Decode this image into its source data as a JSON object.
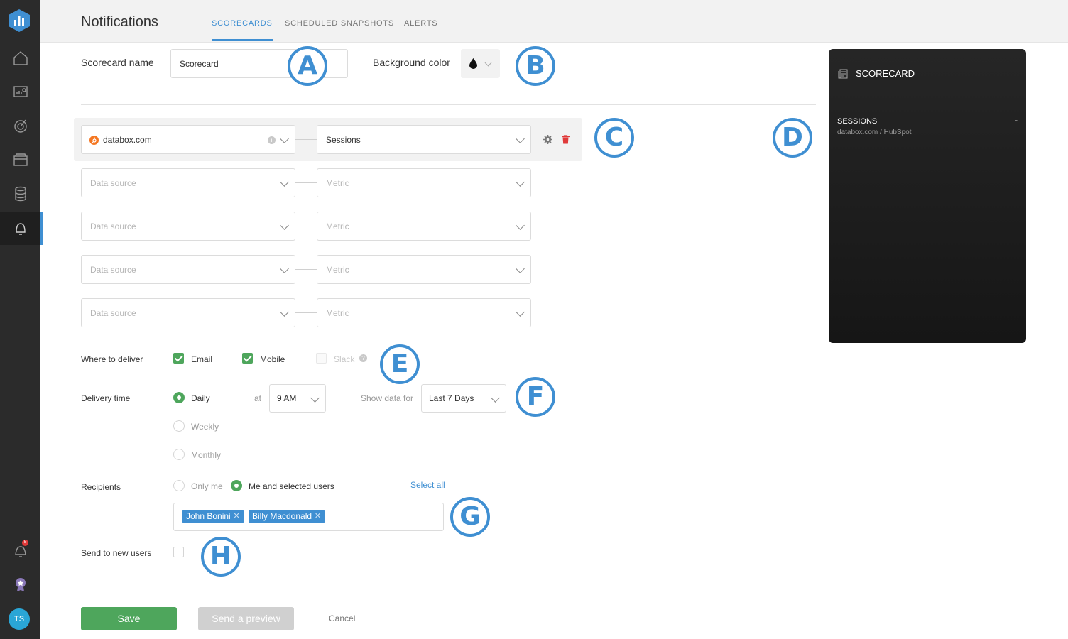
{
  "header": {
    "title": "Notifications",
    "tabs": [
      {
        "label": "SCORECARDS",
        "active": true
      },
      {
        "label": "SCHEDULED SNAPSHOTS",
        "active": false
      },
      {
        "label": "ALERTS",
        "active": false
      }
    ]
  },
  "sidebar": {
    "items": [
      "home-icon",
      "dashboard-icon",
      "goals-icon",
      "databoards-icon",
      "datasources-icon",
      "notifications-icon"
    ],
    "bell_badge": "5",
    "avatar_initials": "TS"
  },
  "form": {
    "scorecard_name_label": "Scorecard name",
    "scorecard_name_value": "Scorecard",
    "background_color_label": "Background color",
    "rows": [
      {
        "source": "databox.com",
        "metric": "Sessions",
        "filled": true
      },
      {
        "source": "Data source",
        "metric": "Metric",
        "filled": false
      },
      {
        "source": "Data source",
        "metric": "Metric",
        "filled": false
      },
      {
        "source": "Data source",
        "metric": "Metric",
        "filled": false
      },
      {
        "source": "Data source",
        "metric": "Metric",
        "filled": false
      }
    ],
    "deliver_label": "Where to deliver",
    "deliver_email": "Email",
    "deliver_mobile": "Mobile",
    "deliver_slack": "Slack",
    "delivery_time_label": "Delivery time",
    "freq_daily": "Daily",
    "freq_weekly": "Weekly",
    "freq_monthly": "Monthly",
    "at_label": "at",
    "time_value": "9 AM",
    "show_data_label": "Show data for",
    "range_value": "Last 7 Days",
    "recipients_label": "Recipients",
    "only_me": "Only me",
    "me_and_selected": "Me and selected users",
    "select_all": "Select all",
    "recipients": [
      "John Bonini",
      "Billy Macdonald"
    ],
    "send_new_users_label": "Send to new users",
    "save": "Save",
    "send_preview": "Send a preview",
    "cancel": "Cancel"
  },
  "preview": {
    "title": "SCORECARD",
    "metric_name": "SESSIONS",
    "metric_source": "databox.com / HubSpot",
    "metric_value": "-"
  },
  "callouts": [
    "A",
    "B",
    "C",
    "D",
    "E",
    "F",
    "G",
    "H"
  ],
  "colors": {
    "accent": "#3f8fd2",
    "success": "#4ea65c",
    "sidebar": "#2b2b2b",
    "hubspot": "#f57722"
  }
}
